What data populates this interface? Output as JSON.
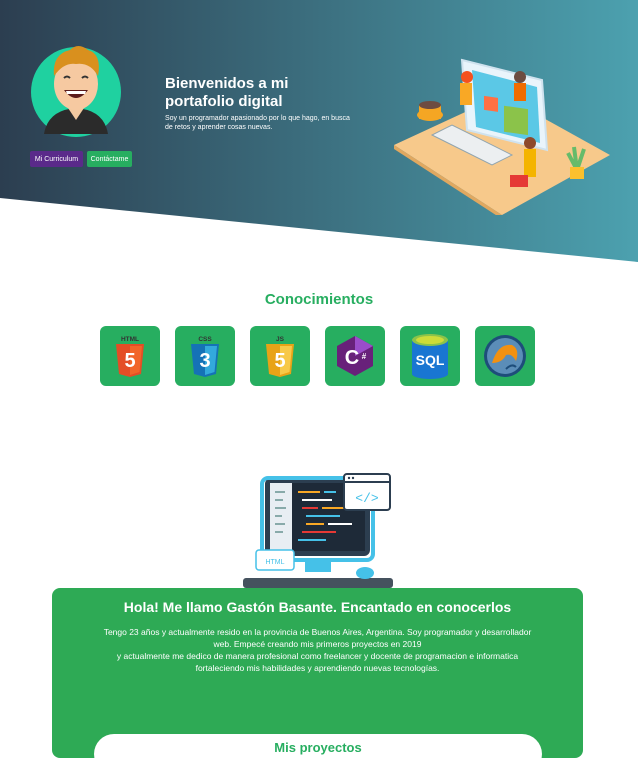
{
  "hero": {
    "title": "Bienvenidos a mi portafolio digital",
    "subtitle": "Soy un programador apasionado por lo que hago, en busca de retos y aprender cosas nuevas.",
    "cv_button": "Mi Curriculum",
    "contact_button": "Contáctame",
    "gradient": [
      "#2c3e50",
      "#4ca1af"
    ]
  },
  "skills": {
    "title": "Conocimientos",
    "items": [
      {
        "label": "HTML",
        "icon": "html5-icon",
        "color": "#e44d26"
      },
      {
        "label": "CSS",
        "icon": "css3-icon",
        "color": "#1572b6"
      },
      {
        "label": "JS",
        "icon": "js-icon",
        "color": "#f0b429"
      },
      {
        "label": "C#",
        "icon": "csharp-icon",
        "color": "#6a1b9a"
      },
      {
        "label": "SQL",
        "icon": "sql-icon",
        "color": "#1976d2"
      },
      {
        "label": "",
        "icon": "mysql-dolphin-icon",
        "color": "#1e4d7a"
      }
    ]
  },
  "illustration": {
    "html_tag": "HTML"
  },
  "about": {
    "title": "Hola! Me llamo Gastón Basante. Encantado en conocerlos",
    "lines": [
      "Tengo 23 años y actualmente resido en la provincia de Buenos Aires, Argentina. Soy programador y desarrollador",
      "web. Empecé creando mis primeros proyectos en 2019",
      "y actualmente me dedico de manera profesional como freelancer y docente de programacion e informatica",
      "fortaleciendo mis habilidades y aprendiendo nuevas tecnologías."
    ],
    "accent": "#27ae60"
  },
  "projects": {
    "title": "Mis proyectos"
  }
}
